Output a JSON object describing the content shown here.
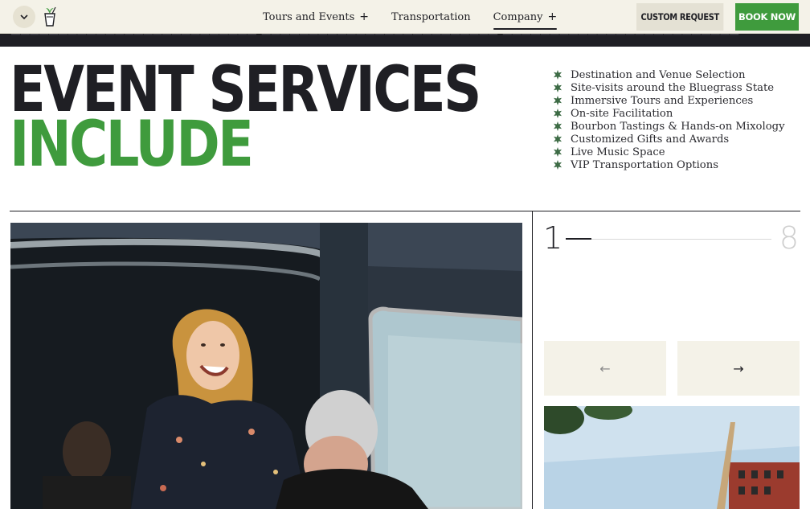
{
  "header": {
    "nav": [
      {
        "label": "Tours and Events",
        "has_submenu": true,
        "submenu_icon": "+"
      },
      {
        "label": "Transportation",
        "has_submenu": false,
        "submenu_icon": ""
      },
      {
        "label": "Company",
        "has_submenu": true,
        "submenu_icon": "+"
      }
    ],
    "custom_request_label": "CUSTOM REQUEST",
    "book_now_label": "BOOK NOW",
    "menu_toggle_icon": "chevron-down-icon",
    "logo_icon": "mint-julep-cup-logo-icon",
    "colors": {
      "cream": "#f4f2e8",
      "green": "#3f9b3d",
      "dark": "#1f1f24"
    }
  },
  "headline": {
    "line1": "EVENT SERVICES",
    "line2": "INCLUDE"
  },
  "services": {
    "bullet_icon": "bourbon-leaf-bullet-icon",
    "items": [
      "Destination and Venue Selection",
      "Site-visits around the Bluegrass State",
      "Immersive Tours and Experiences",
      "On-site Facilitation",
      "Bourbon Tastings & Hands-on Mixology",
      "Customized Gifts and Awards",
      "Live Music Space",
      "VIP Transportation Options"
    ]
  },
  "slider": {
    "current": "1",
    "total": "8",
    "progress_fraction": 0.125,
    "prev_icon": "arrow-left-icon",
    "next_icon": "arrow-right-icon",
    "prev_glyph": "←",
    "next_glyph": "→"
  }
}
